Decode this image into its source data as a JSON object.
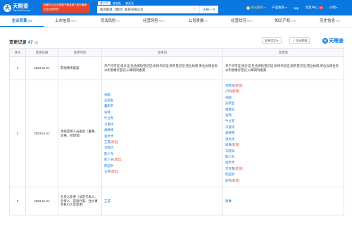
{
  "header": {
    "logo_mark": "天",
    "logo_name": "天眼查",
    "logo_sub": "TianYanCha.com",
    "promo_text": "国家中小企业发展子基金旗下官方备案企业征信机构",
    "search_tabs": [
      "查公司",
      "查老板",
      "查关系"
    ],
    "search_value": "奥克能源（集团）股份有限公司",
    "search_button": "天眼一下",
    "nav": {
      "vip": "会员服务",
      "product": "产品服务",
      "app": "App",
      "messages": "消息中心",
      "messages_badge": "10",
      "user": "小明"
    }
  },
  "tabs": [
    {
      "label": "企业背景",
      "count": "951"
    },
    {
      "label": "上市信息",
      "count": "999+"
    },
    {
      "label": "司法风险",
      "count": "33"
    },
    {
      "label": "经营风险",
      "count": "999+"
    },
    {
      "label": "公司发展",
      "count": "29"
    },
    {
      "label": "经营状况",
      "count": "999+"
    },
    {
      "label": "知识产权",
      "count": "999+"
    },
    {
      "label": "历史信息",
      "count": "204"
    }
  ],
  "section": {
    "title": "变更记录",
    "count": "47",
    "info": "?",
    "filter_button": "变更类型",
    "export_button": "导出数据",
    "brand": "天眼查",
    "brand_mark": "天"
  },
  "table": {
    "headers": [
      "序号",
      "变更日期",
      "变更项目",
      "变更前",
      "变更后"
    ],
    "rows": [
      {
        "index": "1",
        "date": "2023-11-21",
        "item": "其他事项备案",
        "before_text": "开户许可证,统计证,社会保险登记证,机构代码证,税务登记证,营业执照,单位办理住房公积金缴存登记,公章刻制备案",
        "after_text": "开户许可证,统计证,社会保险登记证,机构代码证,税务登记证,营业执照,单位办理住房公积金缴存登记,公章刻制备案"
      },
      {
        "index": "2",
        "date": "2023-11-21",
        "item": "高级管理人员备案（董事、监事、经理等）",
        "before": [
          {
            "name": "卓顺",
            "tag": ""
          },
          {
            "name": "吴荣生",
            "tag": ""
          },
          {
            "name": "董和平",
            "tag": ""
          },
          {
            "name": "张伟",
            "tag": ""
          },
          {
            "name": "牛占军",
            "tag": ""
          },
          {
            "name": "马恩祥",
            "tag": ""
          },
          {
            "name": "胡焕德",
            "tag": ""
          },
          {
            "name": "张文才",
            "tag": ""
          },
          {
            "name": "王成",
            "tag": "[退出]"
          },
          {
            "name": "马晓华",
            "tag": ""
          },
          {
            "name": "陈少东",
            "tag": ""
          },
          {
            "name": "陈少宁",
            "tag": "[退出]"
          },
          {
            "name": "陈超洪",
            "tag": ""
          },
          {
            "name": "王英",
            "tag": "[退出]"
          }
        ],
        "after": [
          {
            "name": "周晓东",
            "tag": "[新增]"
          },
          {
            "name": "卢阳",
            "tag": "[新增]"
          },
          {
            "name": "卓顺",
            "tag": ""
          },
          {
            "name": "吴荣生",
            "tag": ""
          },
          {
            "name": "谢敬东",
            "tag": ""
          },
          {
            "name": "张伟",
            "tag": ""
          },
          {
            "name": "牛占军",
            "tag": ""
          },
          {
            "name": "马恩祥",
            "tag": ""
          },
          {
            "name": "胡焕德",
            "tag": ""
          },
          {
            "name": "张文才",
            "tag": ""
          },
          {
            "name": "闻琳",
            "tag": "[新增]"
          },
          {
            "name": "马晓华",
            "tag": ""
          },
          {
            "name": "陈少东",
            "tag": ""
          },
          {
            "name": "张文才",
            "tag": ""
          },
          {
            "name": "李金春",
            "tag": "[新增]"
          },
          {
            "name": "陈超洪",
            "tag": ""
          },
          {
            "name": "赵扬",
            "tag": "[新增]"
          }
        ]
      },
      {
        "index": "3",
        "date": "2023-11-21",
        "item": "负责人变更（法定代表人、负责人、首席代表、合伙事务执行人等变更）",
        "before_name": "王成",
        "after_name": "周琳"
      }
    ]
  },
  "colors": {
    "brand_blue": "#0a76e0",
    "tag_red": "#e8452c",
    "promo_red": "#e8452c"
  }
}
